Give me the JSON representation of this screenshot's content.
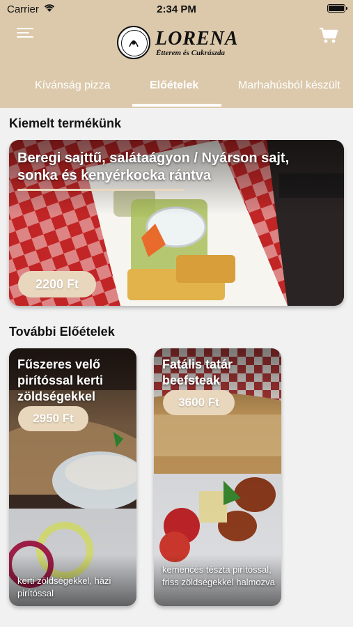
{
  "status": {
    "carrier": "Carrier",
    "time": "2:34 PM"
  },
  "brand": {
    "name": "LORENA",
    "subtitle": "Étterem és Cukrászda",
    "seal_text": "LORENA",
    "accent": "#dcc9ab"
  },
  "tabs": [
    {
      "label": "Kívánság pizza",
      "active": false
    },
    {
      "label": "Előételek",
      "active": true
    },
    {
      "label": "Marhahúsból készült",
      "active": false
    }
  ],
  "featured": {
    "heading": "Kiemelt termékünk",
    "title": "Beregi sajttű, salátaágyon / Nyárson sajt, sonka és kenyérkocka rántva",
    "price": "2200 Ft"
  },
  "more": {
    "heading": "További  Előételek",
    "items": [
      {
        "title": "Fűszeres velő pirítóssal kerti zöldségekkel",
        "price": "2950 Ft",
        "description": "kerti zöldségekkel, házi pirítóssal"
      },
      {
        "title": "Fatális tatár beefsteak",
        "price": "3600 Ft",
        "description": "kemencés tészta pirítóssal, friss zöldségekkel halmozva"
      }
    ]
  }
}
